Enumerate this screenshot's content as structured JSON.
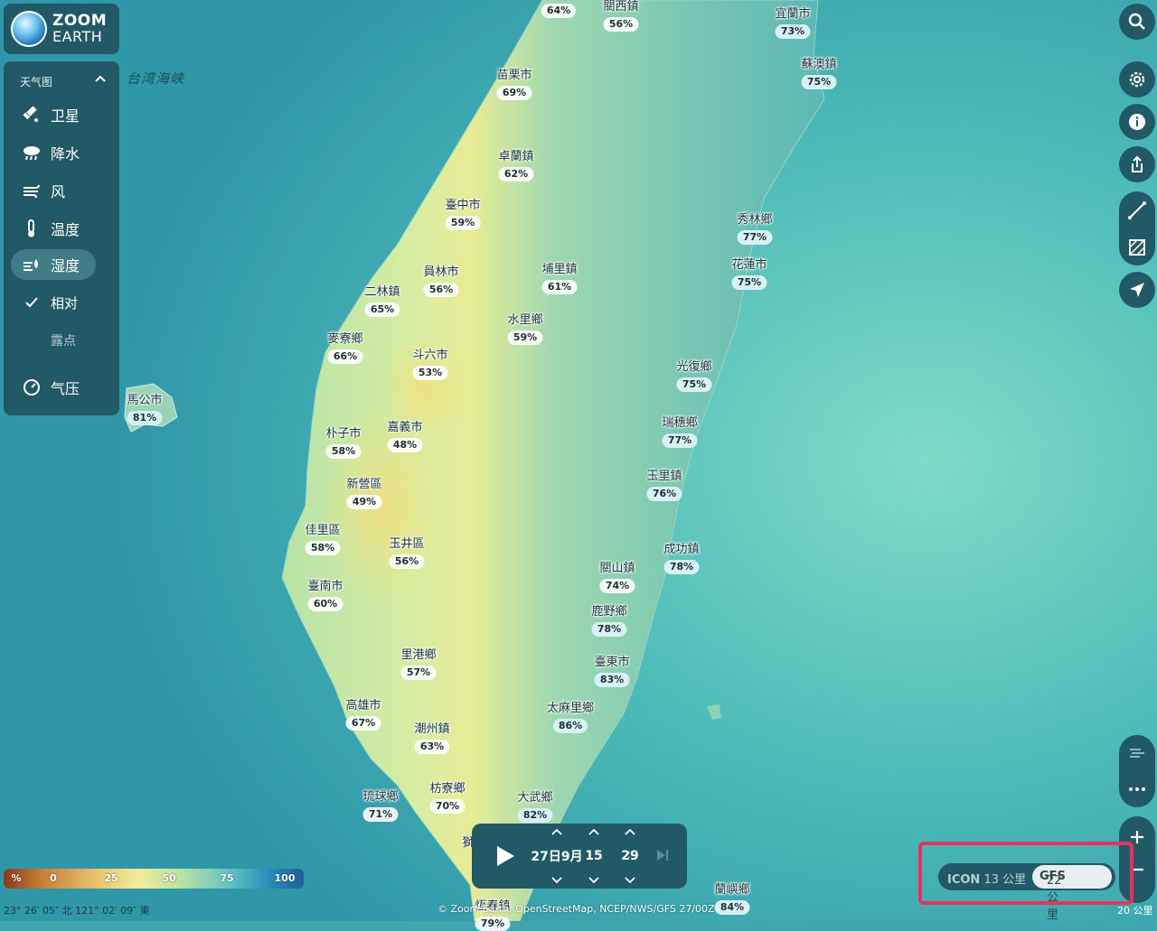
{
  "logo": {
    "line1": "ZOOM",
    "line2": "EARTH"
  },
  "sidebar": {
    "header": "天气图",
    "items": [
      {
        "label": "卫星",
        "icon": "satellite-icon"
      },
      {
        "label": "降水",
        "icon": "rain-cloud-icon"
      },
      {
        "label": "风",
        "icon": "wind-icon"
      },
      {
        "label": "温度",
        "icon": "thermometer-icon"
      },
      {
        "label": "湿度",
        "icon": "humidity-icon",
        "active": true
      },
      {
        "label": "相对",
        "icon": "check-icon",
        "selected": true
      },
      {
        "label": "露点",
        "icon": ""
      },
      {
        "label": "气压",
        "icon": "pressure-gauge-icon"
      }
    ]
  },
  "map": {
    "strait_label": "台湾海峡",
    "places": [
      {
        "name": "關西鎮",
        "value": "56%"
      },
      {
        "name": "",
        "value": "64%"
      },
      {
        "name": "宜蘭市",
        "value": "73%"
      },
      {
        "name": "蘇澳鎮",
        "value": "75%"
      },
      {
        "name": "苗栗市",
        "value": "69%"
      },
      {
        "name": "卓蘭鎮",
        "value": "62%"
      },
      {
        "name": "臺中市",
        "value": "59%"
      },
      {
        "name": "秀林鄉",
        "value": "77%"
      },
      {
        "name": "花蓮市",
        "value": "75%"
      },
      {
        "name": "員林市",
        "value": "56%"
      },
      {
        "name": "埔里鎮",
        "value": "61%"
      },
      {
        "name": "二林鎮",
        "value": "65%"
      },
      {
        "name": "水里鄉",
        "value": "59%"
      },
      {
        "name": "麥寮鄉",
        "value": "66%"
      },
      {
        "name": "斗六市",
        "value": "53%"
      },
      {
        "name": "光復鄉",
        "value": "75%"
      },
      {
        "name": "馬公市",
        "value": "81%"
      },
      {
        "name": "瑞穗鄉",
        "value": "77%"
      },
      {
        "name": "朴子市",
        "value": "58%"
      },
      {
        "name": "嘉義市",
        "value": "48%"
      },
      {
        "name": "玉里鎮",
        "value": "76%"
      },
      {
        "name": "新營區",
        "value": "49%"
      },
      {
        "name": "佳里區",
        "value": "58%"
      },
      {
        "name": "玉井區",
        "value": "56%"
      },
      {
        "name": "成功鎮",
        "value": "78%"
      },
      {
        "name": "關山鎮",
        "value": "74%"
      },
      {
        "name": "臺南市",
        "value": "60%"
      },
      {
        "name": "鹿野鄉",
        "value": "78%"
      },
      {
        "name": "里港鄉",
        "value": "57%"
      },
      {
        "name": "臺東市",
        "value": "83%"
      },
      {
        "name": "太麻里鄉",
        "value": "86%"
      },
      {
        "name": "高雄市",
        "value": "67%"
      },
      {
        "name": "潮州鎮",
        "value": "63%"
      },
      {
        "name": "枋寮鄉",
        "value": "70%"
      },
      {
        "name": "大武鄉",
        "value": "82%"
      },
      {
        "name": "琉球鄉",
        "value": "71%"
      },
      {
        "name": "蘭嶼鄉",
        "value": "84%"
      },
      {
        "name": "恆春鎮",
        "value": "79%"
      },
      {
        "name": "獅",
        "value": ""
      }
    ]
  },
  "legend": {
    "unit": "%",
    "ticks": [
      "0",
      "25",
      "50",
      "75",
      "100"
    ]
  },
  "coords": "23° 26′ 05″ 北   121° 02′ 09″ 東",
  "credits": "© Zoom Earth, OpenStreetMap, NCEP/NWS/GFS 27/00Z",
  "scale_label": "20 公里",
  "timebar": {
    "date": "27日9月",
    "hour": "15",
    "minute": "29"
  },
  "models": {
    "icon_name": "ICON",
    "icon_res": "13 公里",
    "gfs_name": "GFS",
    "gfs_res": "22 公里"
  },
  "colors": {
    "panel": "#215a66",
    "active": "#3f7c86",
    "highlight": "#e8325e"
  }
}
